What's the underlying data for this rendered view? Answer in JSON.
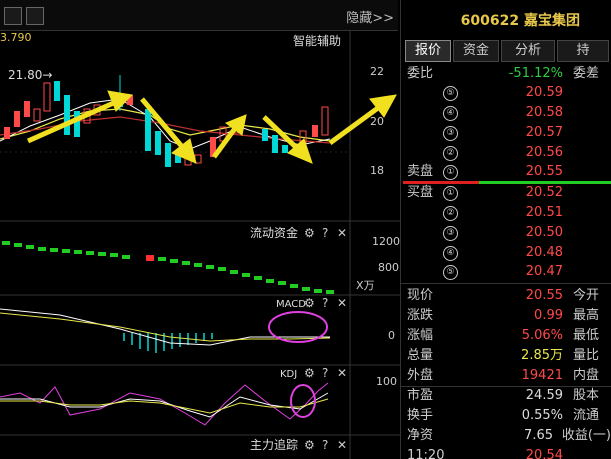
{
  "toolbar": {
    "hide_label": "隐藏>>",
    "price_readout": "3.790"
  },
  "main_chart": {
    "title": "智能辅助",
    "price_label": "21.80→",
    "y_ticks": [
      "22",
      "20",
      "18"
    ]
  },
  "flow_panel": {
    "title": "流动资金",
    "y_ticks": [
      "1200",
      "800"
    ],
    "unit": "X万"
  },
  "macd_panel": {
    "title": "MACD",
    "y_tick": "0"
  },
  "kdj_panel": {
    "title": "KDJ",
    "y_tick": "100"
  },
  "zhuli_panel": {
    "title": "主力追踪"
  },
  "icons": {
    "gear": "⚙",
    "help": "?",
    "close": "✕"
  },
  "stock": {
    "code": "600622",
    "name": "嘉宝集团"
  },
  "tabs": [
    "报价",
    "资金",
    "分析",
    "持"
  ],
  "quote": {
    "weibi_label": "委比",
    "weibi_value": "-51.12%",
    "weicha_label": "委差",
    "sell_label": "卖盘",
    "buy_label": "买盘",
    "sell": [
      {
        "level": "⑤",
        "price": "20.59"
      },
      {
        "level": "④",
        "price": "20.58"
      },
      {
        "level": "③",
        "price": "20.57"
      },
      {
        "level": "②",
        "price": "20.56"
      },
      {
        "level": "①",
        "price": "20.55"
      }
    ],
    "buy": [
      {
        "level": "①",
        "price": "20.52"
      },
      {
        "level": "②",
        "price": "20.51"
      },
      {
        "level": "③",
        "price": "20.50"
      },
      {
        "level": "④",
        "price": "20.48"
      },
      {
        "level": "⑤",
        "price": "20.47"
      }
    ]
  },
  "stats": [
    {
      "label": "现价",
      "value": "20.55",
      "color": "red",
      "label2": "今开"
    },
    {
      "label": "涨跌",
      "value": "0.99",
      "color": "red",
      "label2": "最高"
    },
    {
      "label": "涨幅",
      "value": "5.06%",
      "color": "red",
      "label2": "最低"
    },
    {
      "label": "总量",
      "value": "2.85万",
      "color": "yellow",
      "label2": "量比"
    },
    {
      "label": "外盘",
      "value": "19421",
      "color": "red",
      "label2": "内盘"
    },
    {
      "label": "市盈",
      "value": "24.59",
      "color": "white",
      "label2": "股本"
    },
    {
      "label": "换手",
      "value": "0.55%",
      "color": "white",
      "label2": "流通"
    },
    {
      "label": "净资",
      "value": "7.65",
      "color": "white",
      "label2": "收益(一)"
    }
  ],
  "bottom_time": "11:20",
  "bottom_price": "20.54",
  "colors": {
    "up": "#ff4a4a",
    "down": "#22cc22",
    "ma_yellow": "#e8e84a",
    "arrow": "#f0e020",
    "highlight": "#e040e0"
  }
}
